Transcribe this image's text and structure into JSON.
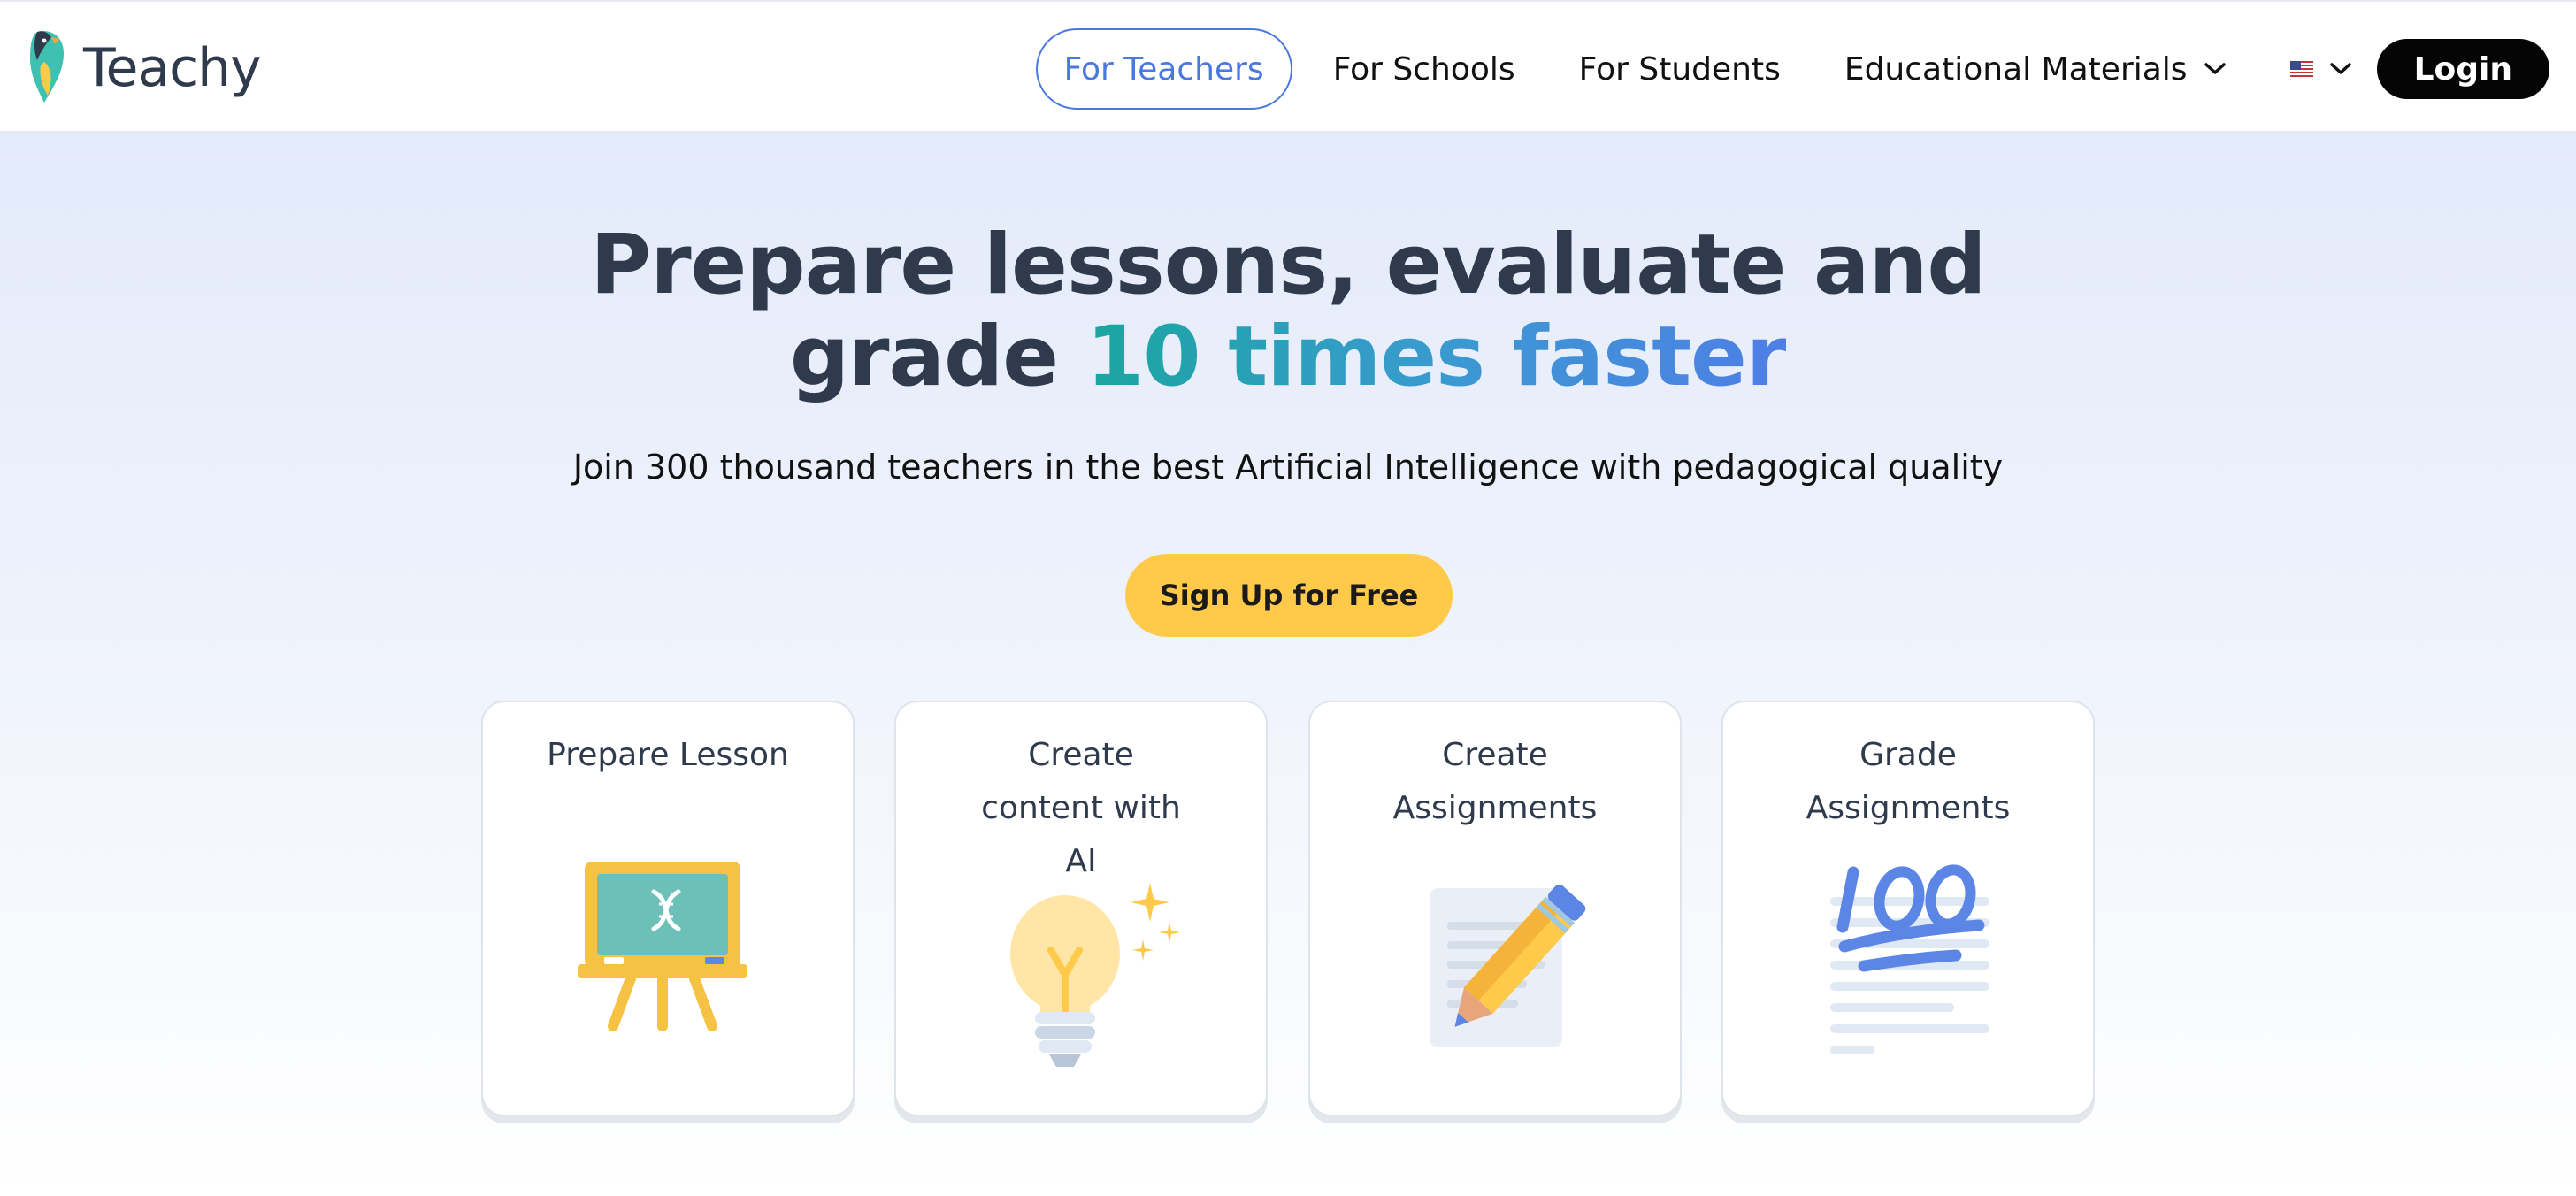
{
  "header": {
    "logo_text": "Teachy",
    "nav": {
      "for_teachers": "For Teachers",
      "for_schools": "For Schools",
      "for_students": "For Students",
      "educational_materials": "Educational Materials"
    },
    "language_icon": "us-flag-icon",
    "login_label": "Login"
  },
  "hero": {
    "headline_line1": "Prepare lessons, evaluate and",
    "headline_line2_prefix": "grade ",
    "headline_highlight": "10 times faster",
    "subtitle": "Join 300 thousand teachers in the best Artificial Intelligence with pedagogical quality",
    "cta_label": "Sign Up for Free"
  },
  "cards": [
    {
      "title": "Prepare Lesson",
      "icon": "chalkboard-icon"
    },
    {
      "title": "Create content with AI",
      "icon": "lightbulb-icon"
    },
    {
      "title": "Create Assignments",
      "icon": "pencil-paper-icon"
    },
    {
      "title": "Grade Assignments",
      "icon": "hundred-points-icon"
    }
  ],
  "colors": {
    "accent_blue": "#4a78e0",
    "cta_yellow": "#ffc94a",
    "headline_teal": "#1aa6a0",
    "text_dark": "#2f3b4d"
  }
}
